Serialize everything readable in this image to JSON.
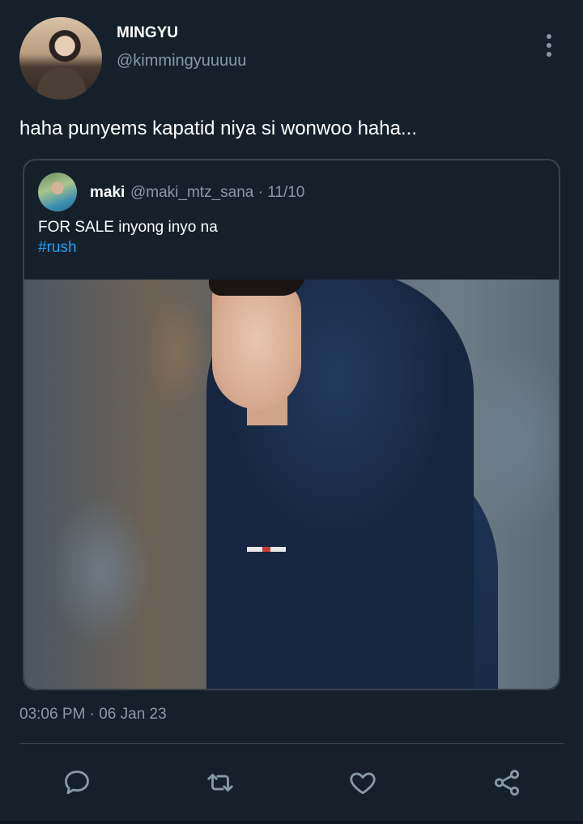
{
  "tweet": {
    "author": {
      "display_name": "MINGYU",
      "handle": "@kimmingyuuuuu"
    },
    "text": "haha punyems kapatid niya si wonwoo haha...",
    "quoted": {
      "display_name": "maki",
      "meta": "@maki_mtz_sana · 11/10",
      "text": "FOR SALE inyong inyo na",
      "hashtag": "#rush"
    },
    "timestamp": "03:06 PM · 06 Jan 23"
  },
  "actions": [
    {
      "icon": "reply-icon"
    },
    {
      "icon": "retweet-icon"
    },
    {
      "icon": "like-icon"
    },
    {
      "icon": "share-icon"
    }
  ],
  "colors": {
    "background": "#15202b",
    "secondary_text": "#8899a6",
    "link": "#1da1f2",
    "border": "#38444d"
  }
}
